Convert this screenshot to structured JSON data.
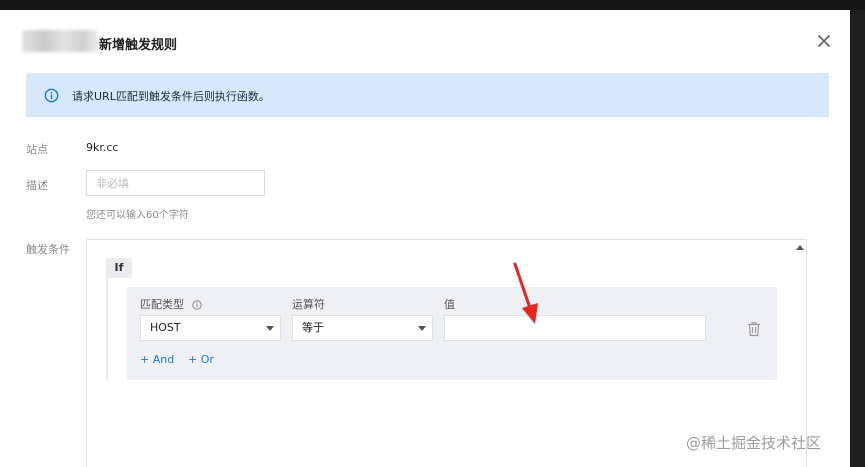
{
  "dialog": {
    "title": "新增触发规则",
    "info_text": "请求URL匹配到触发条件后则执行函数。"
  },
  "form": {
    "site_label": "站点",
    "site_value": "9kr.cc",
    "desc_label": "描述",
    "desc_placeholder": "非必填",
    "desc_value": "",
    "desc_hint": "您还可以输入60个字符",
    "condition_label": "触发条件"
  },
  "condition": {
    "if_label": "If",
    "match_type_label": "匹配类型",
    "operator_label": "运算符",
    "value_label": "值",
    "match_type_selected": "HOST",
    "operator_selected": "等于",
    "value": "",
    "and_label": "+ And",
    "or_label": "+ Or"
  },
  "colors": {
    "accent": "#1f73e8",
    "info_bg": "#d7e8fb",
    "arrow": "#e8251f"
  },
  "watermark": "@稀土掘金技术社区"
}
